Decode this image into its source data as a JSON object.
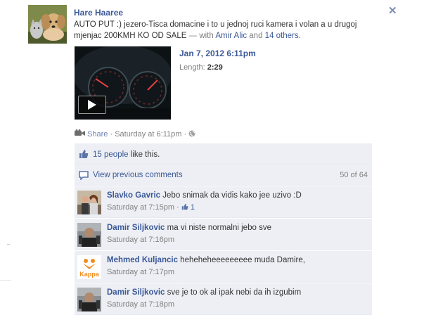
{
  "post": {
    "author": "Hare Haaree",
    "message": "AUTO PUT :) jezero-Tisca domacine i to u jednoj ruci kamera i volan a u drugoj mjenjac 200KMH KO OD SALE",
    "with_prefix": "— with",
    "tagged": "Amir Alic",
    "and_text": "and",
    "others": "14 others."
  },
  "video": {
    "date": "Jan 7, 2012 6:11pm",
    "length_label": "Length:",
    "length_value": "2:29"
  },
  "actions": {
    "share": "Share",
    "sep": "·",
    "timestamp": "Saturday at 6:11pm"
  },
  "likes": {
    "people": "15 people",
    "suffix": "like this."
  },
  "comments_header": {
    "view_previous": "View previous comments",
    "count": "50 of 64"
  },
  "comments": [
    {
      "name": "Slavko Gavric",
      "text": "Jebo snimak da vidis kako jee uzivo :D",
      "time": "Saturday at 7:15pm",
      "likes": "1"
    },
    {
      "name": "Damir Siljkovic",
      "text": "ma vi niste normalni jebo sve",
      "time": "Saturday at 7:16pm"
    },
    {
      "name": "Mehmed Kuljancic",
      "text": "heheheheeeeeeeee muda Damire,",
      "time": "Saturday at 7:17pm"
    },
    {
      "name": "Damir Siljkovic",
      "text": "sve je to ok al ipak nebi da ih izgubim",
      "time": "Saturday at 7:18pm"
    }
  ],
  "avatar_labels": {
    "kappa": "Kappa"
  },
  "colors": {
    "link": "#3b5998",
    "ufi_bg": "#edeff4",
    "meta": "#808080"
  }
}
